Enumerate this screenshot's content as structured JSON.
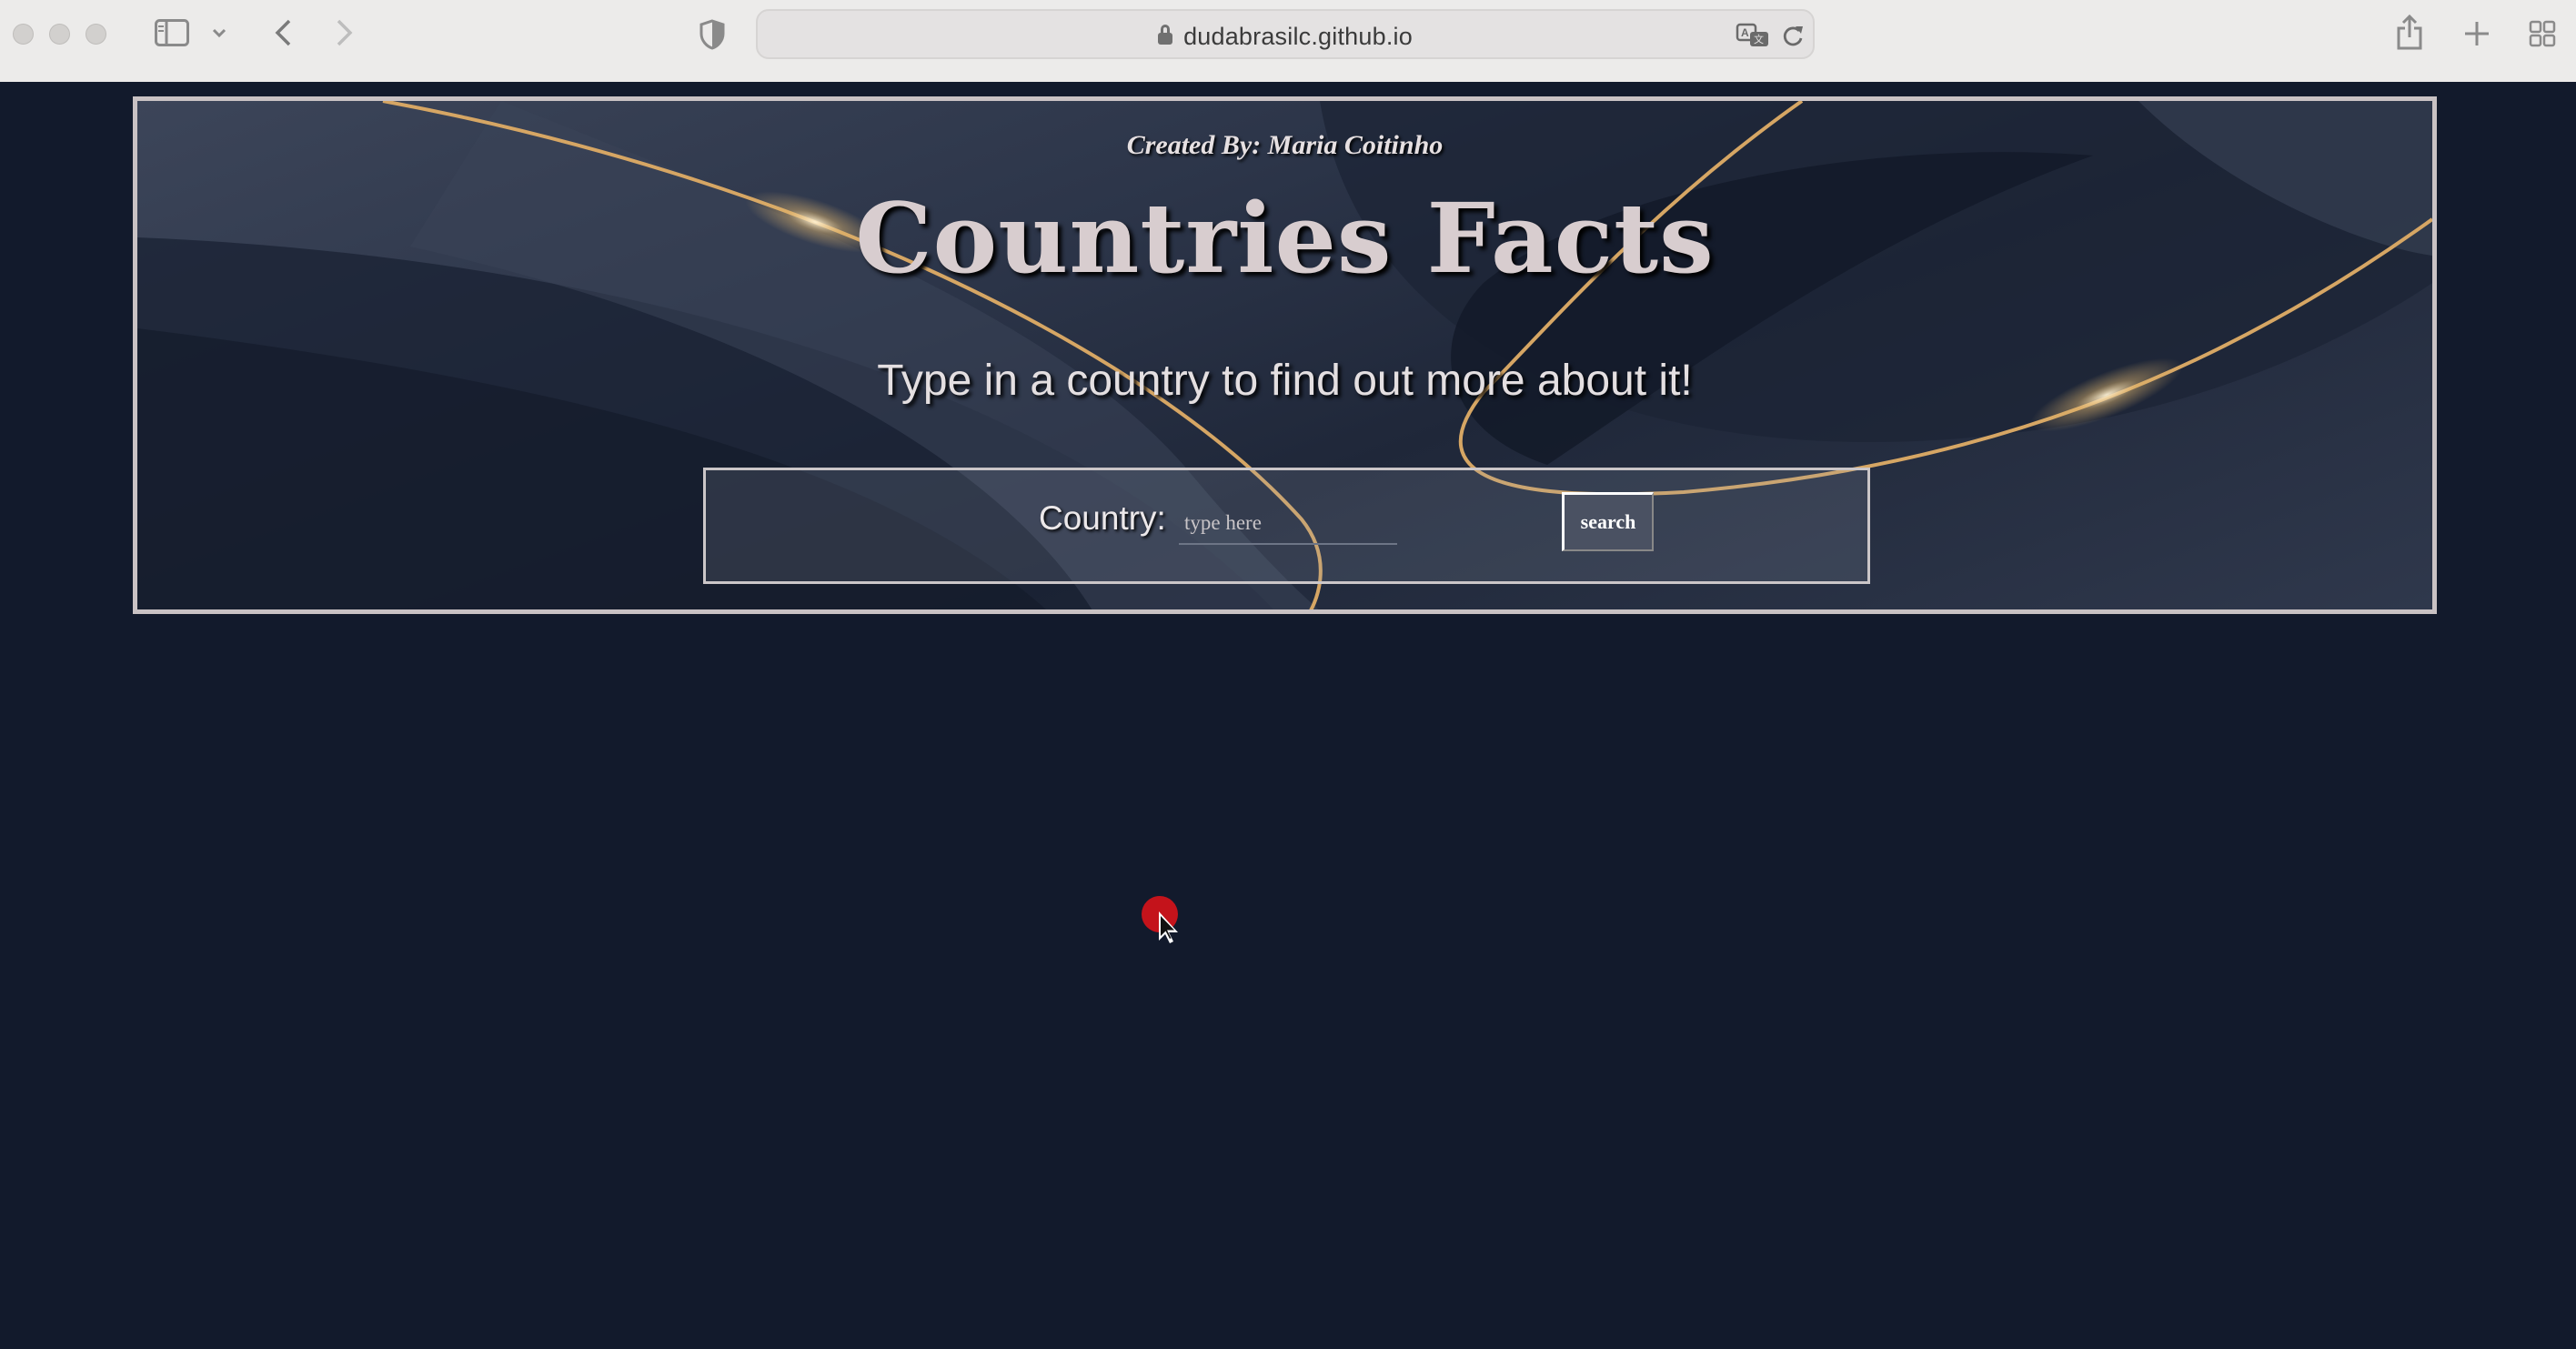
{
  "browser": {
    "url": "dudabrasilc.github.io",
    "icons": [
      "sidebar-icon",
      "chevron-down-icon",
      "back-icon",
      "forward-icon",
      "shield-icon",
      "lock-icon",
      "translate-icon",
      "reload-icon",
      "share-icon",
      "new-tab-icon",
      "tab-overview-icon"
    ]
  },
  "hero": {
    "created_by": "Created By: Maria Coitinho",
    "title": "Countries Facts",
    "subtitle": "Type in a country to find out more about it!"
  },
  "search": {
    "label": "Country:",
    "placeholder": "type here",
    "value": "",
    "button_label": "search"
  },
  "colors": {
    "page_bg": "#121a2c",
    "accent_gold": "#d6a664",
    "border": "#c9c2c4"
  }
}
